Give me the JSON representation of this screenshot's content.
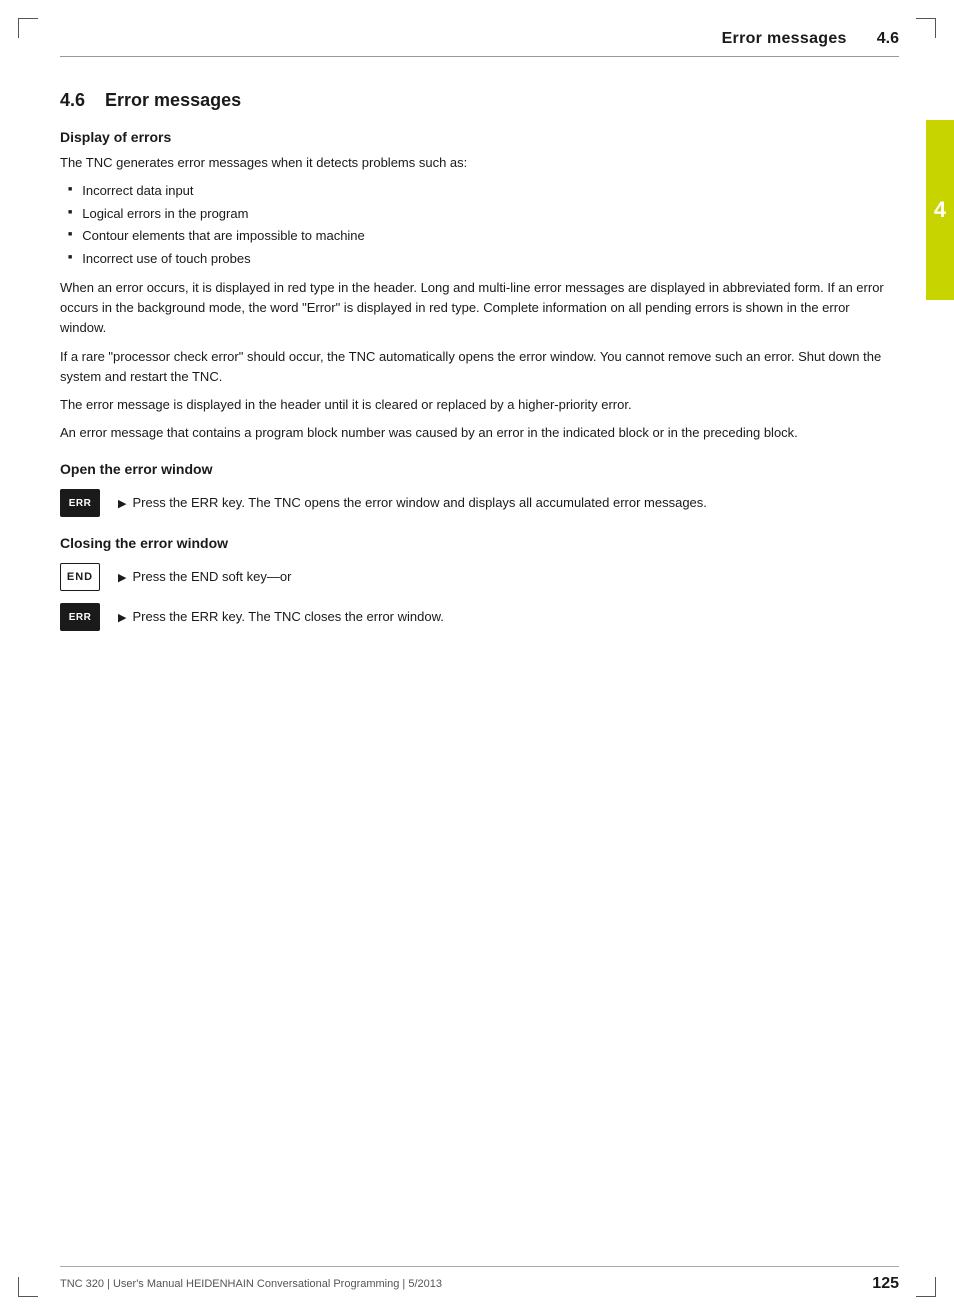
{
  "page": {
    "header": {
      "title": "Error messages",
      "section": "4.6"
    },
    "footer": {
      "text": "TNC 320 | User's Manual HEIDENHAIN Conversational Programming | 5/2013",
      "page_number": "125"
    },
    "side_tab": {
      "number": "4"
    }
  },
  "section": {
    "number": "4.6",
    "title": "Error messages"
  },
  "subsections": {
    "display_of_errors": {
      "heading": "Display of errors",
      "intro": "The TNC generates error messages when it detects problems such as:",
      "bullet_items": [
        "Incorrect data input",
        "Logical errors in the program",
        "Contour elements that are impossible to machine",
        "Incorrect use of touch probes"
      ],
      "paragraphs": [
        "When an error occurs, it is displayed in red type in the header. Long and multi-line error messages are displayed in abbreviated form. If an error occurs in the background mode, the word \"Error\" is displayed in red type. Complete information on all pending errors is shown in the error window.",
        "If a rare \"processor check error\" should occur, the TNC automatically opens the error window. You cannot remove such an error. Shut down the system and restart the TNC.",
        "The error message is displayed in the header until it is cleared or replaced by a higher-priority error.",
        "An error message that contains a program block number was caused by an error in the indicated block or in the preceding block."
      ]
    },
    "open_error_window": {
      "heading": "Open the error window",
      "instructions": [
        {
          "key_label": "ERR",
          "key_type": "dark",
          "description": "Press the ERR key. The TNC opens the error window and displays all accumulated error messages."
        }
      ]
    },
    "closing_error_window": {
      "heading": "Closing the error window",
      "instructions": [
        {
          "key_label": "END",
          "key_type": "light",
          "description": "Press the END soft key—or"
        },
        {
          "key_label": "ERR",
          "key_type": "dark",
          "description": "Press the ERR key. The TNC closes the error window."
        }
      ]
    }
  },
  "labels": {
    "arrow": "▶"
  }
}
